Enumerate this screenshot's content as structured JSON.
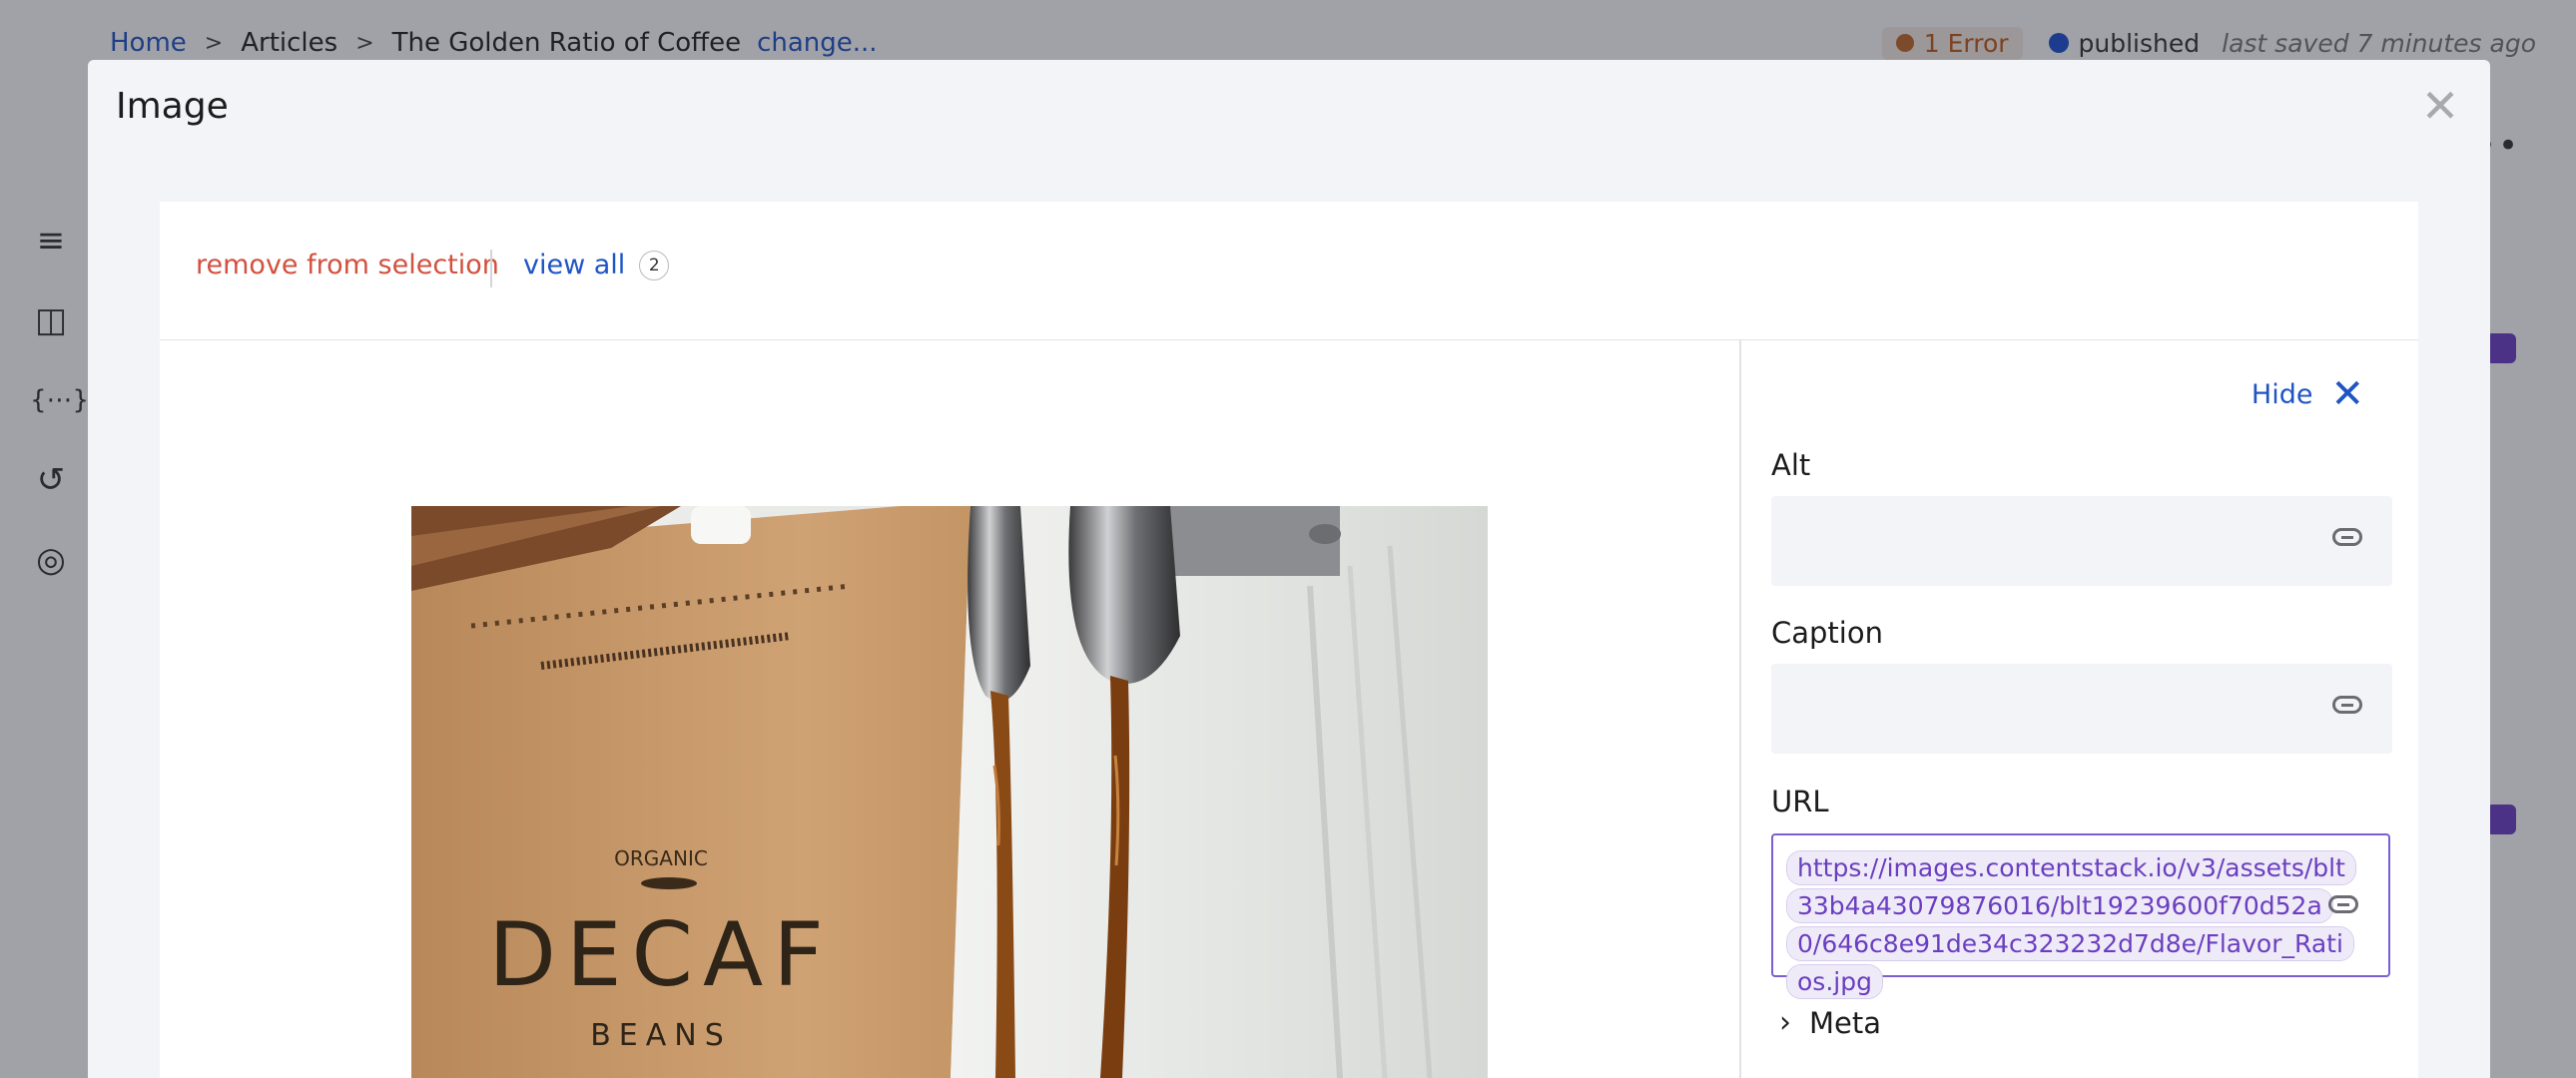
{
  "header": {
    "breadcrumb": [
      "Home",
      "Articles",
      "The Golden Ratio of Coffee"
    ],
    "change_link": "change...",
    "error_label": "1 Error",
    "status_label": "published",
    "saved_label": "last saved 7 minutes ago"
  },
  "modal": {
    "title": "Image",
    "selection": {
      "remove_label": "remove from selection",
      "view_all_label": "view all",
      "count": "2"
    },
    "sidepanel": {
      "hide_label": "Hide",
      "fields": {
        "alt_label": "Alt",
        "alt_value": "",
        "caption_label": "Caption",
        "caption_value": "",
        "url_label": "URL",
        "url_value": "https://images.contentstack.io/v3/assets/blt33b4a43079876016/blt19239600f70d52a0/646c8e91de34c323232d7d8e/Flavor_Ratios.jpg"
      },
      "meta_label": "Meta"
    },
    "image_text": {
      "line1": "ORGANIC",
      "line2": "DECAF",
      "line3": "BEANS"
    }
  },
  "icons": {
    "back": "chevron-left-icon",
    "close": "close-icon",
    "hide": "close-icon",
    "link": "link-icon",
    "meta": "chevron-right-icon"
  },
  "colors": {
    "link_blue": "#1f54c4",
    "remove_red": "#d2503f",
    "url_purple": "#6a3fbf",
    "error_orange": "#c05a17",
    "published_dot": "#1e50d0"
  }
}
